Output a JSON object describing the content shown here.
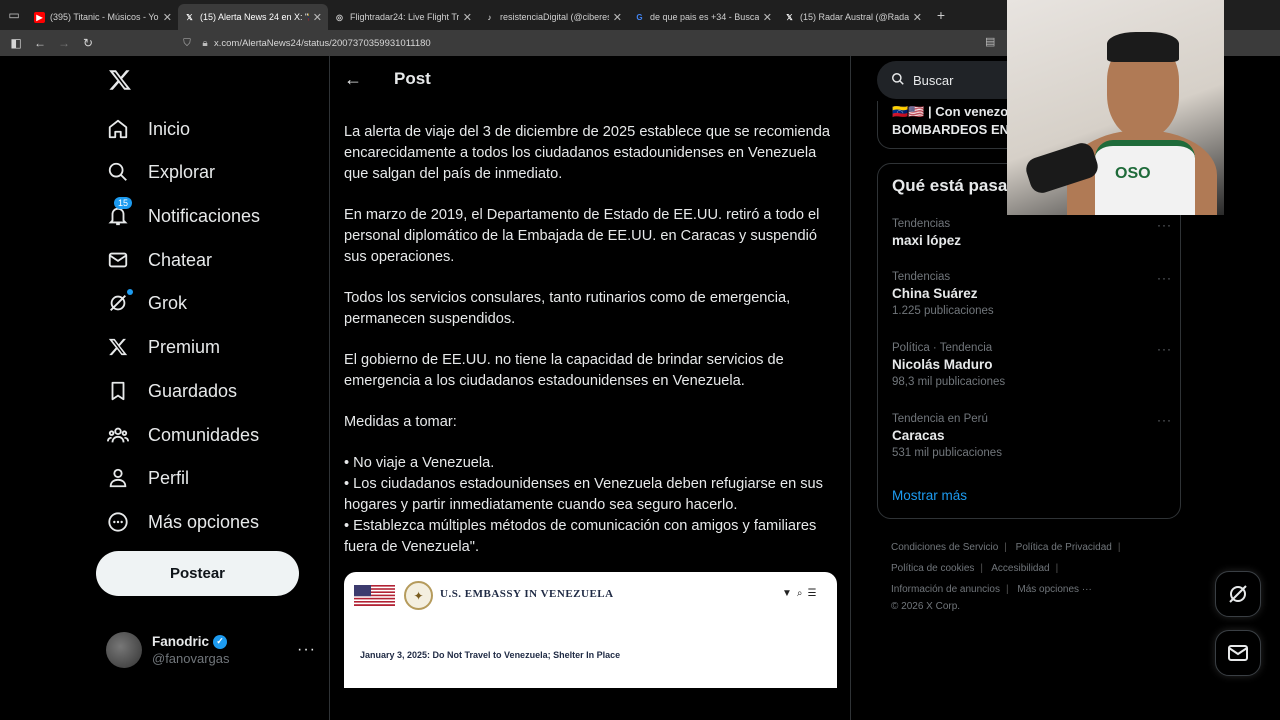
{
  "browser": {
    "tabs": [
      {
        "title": "(395) Titanic - Músicos - YouTube",
        "icon": "youtube-icon",
        "color": "#ff0000",
        "active": false
      },
      {
        "title": "(15) Alerta News 24 en X: \"🇻🇪🇺🇸",
        "icon": "x-icon",
        "color": "#ffffff",
        "active": true
      },
      {
        "title": "Flightradar24: Live Flight Tracker",
        "icon": "globe-icon",
        "color": "#cccccc",
        "active": false
      },
      {
        "title": "resistenciaDigital (@ciberesistencia)",
        "icon": "tiktok-icon",
        "color": "#ffffff",
        "active": false
      },
      {
        "title": "de que pais es +34 - Buscar con Google",
        "icon": "google-icon",
        "color": "#4285f4",
        "active": false
      },
      {
        "title": "(15) Radar Austral (@RadarAustral)",
        "icon": "x-icon",
        "color": "#ffffff",
        "active": false
      }
    ],
    "url": "x.com/AlertaNews24/status/2007370359931011180"
  },
  "sidebar": {
    "items": [
      {
        "label": "Inicio",
        "icon": "home-icon"
      },
      {
        "label": "Explorar",
        "icon": "search-icon"
      },
      {
        "label": "Notificaciones",
        "icon": "bell-icon",
        "badge": "15"
      },
      {
        "label": "Chatear",
        "icon": "mail-icon"
      },
      {
        "label": "Grok",
        "icon": "grok-icon"
      },
      {
        "label": "Premium",
        "icon": "x-logo-icon"
      },
      {
        "label": "Guardados",
        "icon": "bookmark-icon"
      },
      {
        "label": "Comunidades",
        "icon": "communities-icon"
      },
      {
        "label": "Perfil",
        "icon": "person-icon"
      },
      {
        "label": "Más opciones",
        "icon": "more-circle-icon"
      }
    ],
    "post_button": "Postear",
    "user": {
      "name": "Fanodric",
      "handle": "@fanovargas"
    }
  },
  "main": {
    "header_title": "Post",
    "paragraphs": [
      "La alerta de viaje del 3 de diciembre de 2025 establece que se recomienda encarecidamente a todos los ciudadanos estadounidenses en Venezuela que salgan del país de inmediato.",
      "En marzo de 2019, el Departamento de Estado de EE.UU. retiró a todo el personal diplomático de la Embajada de EE.UU. en Caracas y suspendió sus operaciones.",
      "Todos los servicios consulares, tanto rutinarios como de emergencia, permanecen suspendidos.",
      "El gobierno de EE.UU. no tiene la capacidad de brindar servicios de emergencia a los ciudadanos estadounidenses en Venezuela.",
      "Medidas a tomar:"
    ],
    "bullets": [
      "• No viaje a Venezuela.",
      "• Los ciudadanos estadounidenses en Venezuela deben refugiarse en sus hogares y partir inmediatamente cuando sea seguro hacerlo.",
      "• Establezca múltiples métodos de comunicación con amigos y familiares fuera de Venezuela\"."
    ],
    "embassy": {
      "title": "U.S. EMBASSY IN VENEZUELA",
      "headline": "January 3, 2025: Do Not Travel to Venezuela; Shelter In Place"
    }
  },
  "right": {
    "search_placeholder": "Buscar",
    "promo_line1": "🇻🇪🇺🇸 | Con venezo",
    "promo_line2": "BOMBARDEOS EN",
    "trends_title": "Qué está pasa",
    "trends": [
      {
        "category": "Tendencias",
        "name": "maxi lópez",
        "count": ""
      },
      {
        "category": "Tendencias",
        "name": "China Suárez",
        "count": "1.225 publicaciones"
      },
      {
        "category": "Política · Tendencia",
        "name": "Nicolás Maduro",
        "count": "98,3 mil publicaciones"
      },
      {
        "category": "Tendencia en Perú",
        "name": "Caracas",
        "count": "531 mil publicaciones"
      }
    ],
    "show_more": "Mostrar más",
    "footer": {
      "terms": "Condiciones de Servicio",
      "privacy": "Política de Privacidad",
      "cookies": "Política de cookies",
      "accessibility": "Accesibilidad",
      "ads": "Información de anuncios",
      "more": "Más opciones ···",
      "copyright": "© 2026 X Corp."
    }
  },
  "overlay": {
    "jersey_text": "OSO"
  },
  "colors": {
    "accent": "#1d9bf0",
    "background": "#000000",
    "border": "#2f3336",
    "muted": "#71767b"
  }
}
